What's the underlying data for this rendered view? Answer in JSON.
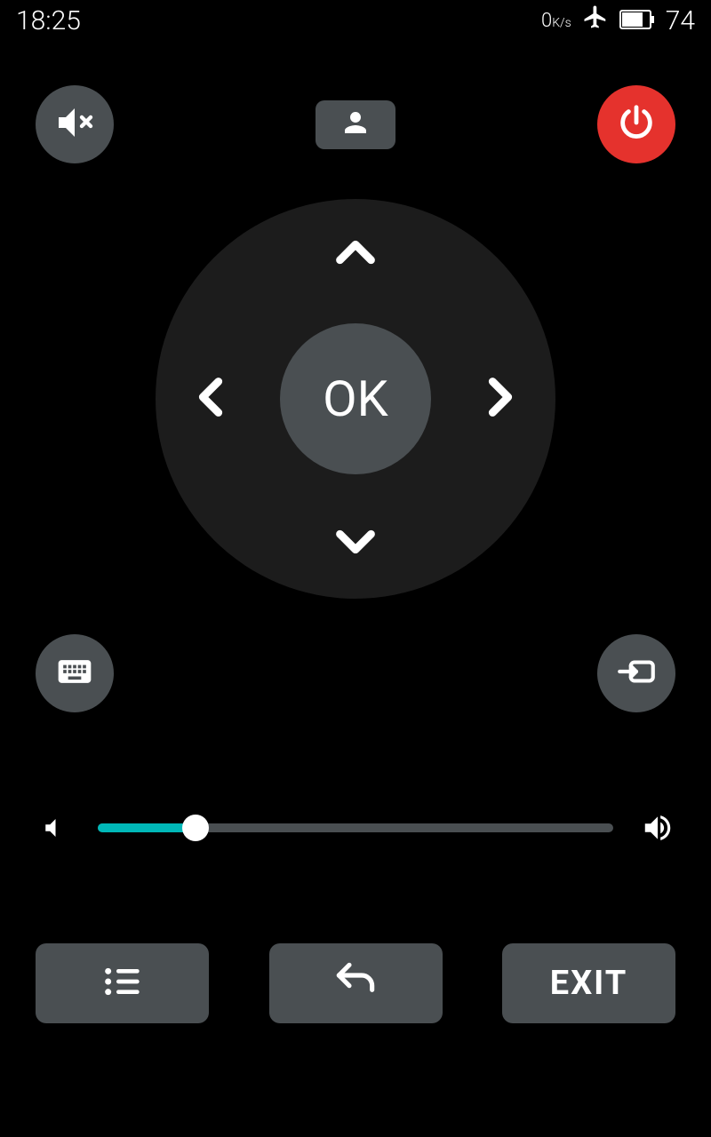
{
  "status": {
    "time": "18:25",
    "speed_value": "0",
    "speed_unit": "K/s",
    "battery": "74"
  },
  "dpad": {
    "ok_label": "OK"
  },
  "volume": {
    "percent": 19
  },
  "bottom": {
    "exit_label": "EXIT"
  },
  "icons": {
    "mute": "mute-icon",
    "profile": "profile-icon",
    "power": "power-icon",
    "keyboard": "keyboard-icon",
    "input": "input-source-icon",
    "menu": "menu-list-icon",
    "back": "back-arrow-icon",
    "vol_low": "volume-low-icon",
    "vol_high": "volume-high-icon",
    "airplane": "airplane-icon",
    "battery": "battery-icon"
  }
}
